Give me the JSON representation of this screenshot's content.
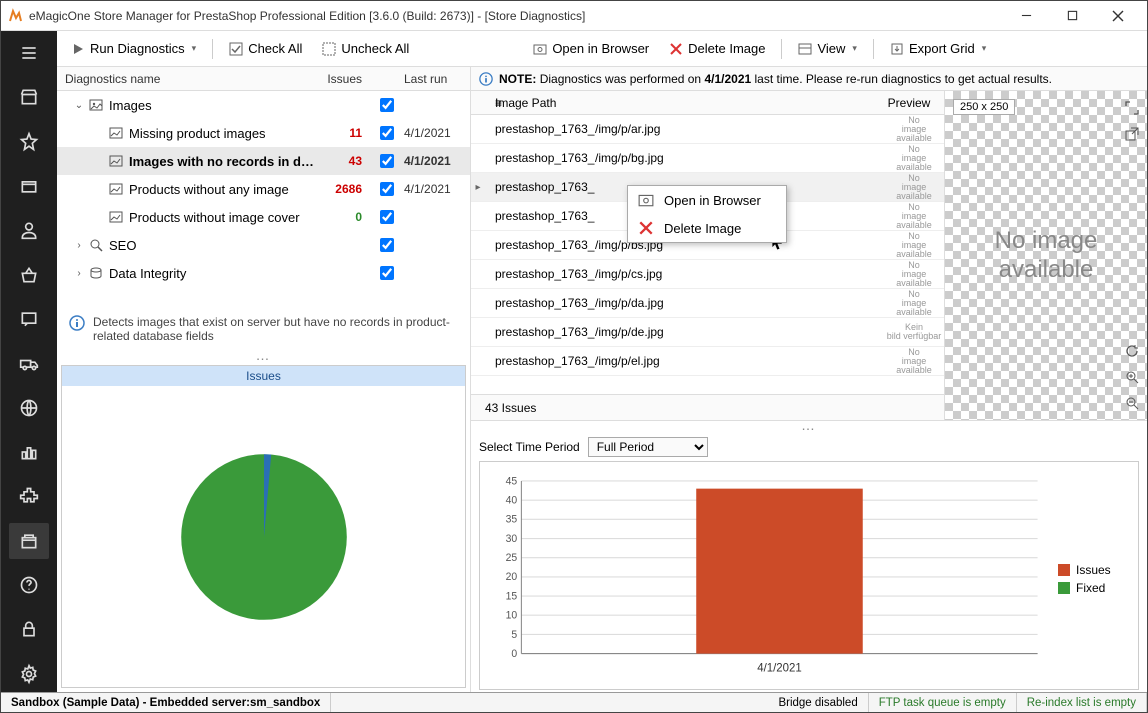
{
  "window": {
    "title": "eMagicOne Store Manager for PrestaShop Professional Edition [3.6.0 (Build: 2673)] - [Store Diagnostics]"
  },
  "toolbar_left": {
    "run": "Run Diagnostics",
    "check_all": "Check All",
    "uncheck_all": "Uncheck All"
  },
  "toolbar_right": {
    "open_browser": "Open in Browser",
    "delete_image": "Delete Image",
    "view": "View",
    "export_grid": "Export Grid"
  },
  "tree_header": {
    "name": "Diagnostics name",
    "issues": "Issues",
    "last": "Last run"
  },
  "tree": {
    "images_group": "Images",
    "items": [
      {
        "label": "Missing product images",
        "issues": "11",
        "last": "4/1/2021",
        "zero": false
      },
      {
        "label": "Images with no records in database",
        "issues": "43",
        "last": "4/1/2021",
        "zero": false,
        "selected": true
      },
      {
        "label": "Products without any image",
        "issues": "2686",
        "last": "4/1/2021",
        "zero": false
      },
      {
        "label": "Products without image cover",
        "issues": "0",
        "last": "",
        "zero": true
      }
    ],
    "seo_group": "SEO",
    "data_integrity_group": "Data Integrity"
  },
  "description": "Detects images that exist on server but have no records in product-related database fields",
  "pie": {
    "title": "Issues"
  },
  "note": {
    "prefix": "NOTE:",
    "text1": "Diagnostics was performed on",
    "date": "4/1/2021",
    "text2": "last time. Please re-run diagnostics to get actual results."
  },
  "grid_header": {
    "path": "Image Path",
    "preview": "Preview"
  },
  "grid_rows": [
    {
      "a": "prestashop_1763_",
      "b": "/img/p/ar.jpg",
      "p": "No image available"
    },
    {
      "a": "prestashop_1763_",
      "b": "/img/p/bg.jpg",
      "p": "No image available"
    },
    {
      "a": "prestashop_1763_",
      "b": "",
      "p": "No image available",
      "sel": true
    },
    {
      "a": "prestashop_1763_",
      "b": "",
      "p": "No image available"
    },
    {
      "a": "prestashop_1763_",
      "b": "/img/p/bs.jpg",
      "p": "No image available"
    },
    {
      "a": "prestashop_1763_",
      "b": "/img/p/cs.jpg",
      "p": "No image available"
    },
    {
      "a": "prestashop_1763_",
      "b": "/img/p/da.jpg",
      "p": "No image available"
    },
    {
      "a": "prestashop_1763_",
      "b": "/img/p/de.jpg",
      "p": "Kein bild verfügbar"
    },
    {
      "a": "prestashop_1763_",
      "b": "/img/p/el.jpg",
      "p": "No image available"
    }
  ],
  "grid_footer": "43 Issues",
  "preview": {
    "size": "250 x 250",
    "noimg1": "No image",
    "noimg2": "available"
  },
  "context": {
    "open": "Open in Browser",
    "delete": "Delete Image"
  },
  "period": {
    "label": "Select Time Period",
    "value": "Full Period"
  },
  "chart_data": {
    "type": "bar",
    "categories": [
      "4/1/2021"
    ],
    "series": [
      {
        "name": "Issues",
        "values": [
          43
        ],
        "color": "#cc4b28"
      },
      {
        "name": "Fixed",
        "values": [
          0
        ],
        "color": "#3a9a3a"
      }
    ],
    "ylim": [
      0,
      45
    ],
    "yticks": [
      0,
      5,
      10,
      15,
      20,
      25,
      30,
      35,
      40,
      45
    ]
  },
  "legend": {
    "issues": "Issues",
    "fixed": "Fixed"
  },
  "status": {
    "sandbox": "Sandbox (Sample Data) - Embedded server:sm_sandbox",
    "bridge": "Bridge disabled",
    "ftp": "FTP task queue is empty",
    "reindex": "Re-index list is empty"
  }
}
